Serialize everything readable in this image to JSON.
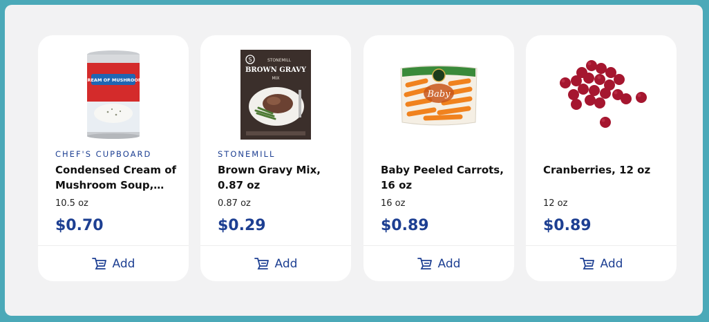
{
  "products": [
    {
      "brand": "CHEF'S CUPBOARD",
      "name": "Condensed Cream of Mushroom Soup, 10...",
      "size": "10.5 oz",
      "price": "$0.70",
      "add_label": "Add",
      "image": {
        "icon": "soup-can-image",
        "label_text": "CREAM OF MUSHROOM"
      }
    },
    {
      "brand": "STONEMILL",
      "name": "Brown Gravy Mix, 0.87 oz",
      "size": "0.87 oz",
      "price": "$0.29",
      "add_label": "Add",
      "image": {
        "icon": "gravy-packet-image",
        "label_text": "BROWN GRAVY",
        "sub_text": "MIX"
      }
    },
    {
      "brand": "",
      "name": "Baby Peeled Carrots, 16 oz",
      "size": "16 oz",
      "price": "$0.89",
      "add_label": "Add",
      "image": {
        "icon": "carrot-bag-image",
        "label_text": "Baby"
      }
    },
    {
      "brand": "",
      "name": "Cranberries, 12 oz",
      "size": "12 oz",
      "price": "$0.89",
      "add_label": "Add",
      "image": {
        "icon": "cranberries-image"
      }
    }
  ],
  "colors": {
    "outer_border": "#4ba9b8",
    "background": "#f2f2f3",
    "brand_blue": "#1d3f92",
    "card": "#ffffff"
  }
}
